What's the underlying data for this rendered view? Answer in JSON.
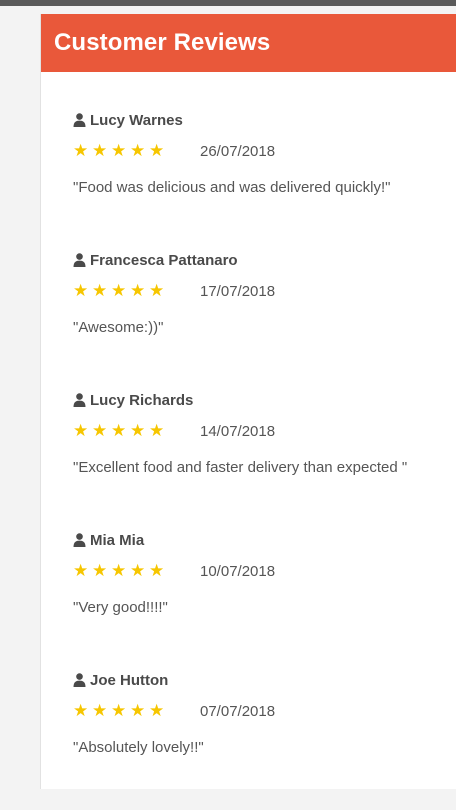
{
  "header": {
    "title": "Customer Reviews"
  },
  "colors": {
    "header_bg": "#e9583a",
    "star": "#f6c600",
    "top_bar": "#5a5a5a"
  },
  "reviews": [
    {
      "name": "Lucy Warnes",
      "rating": 5,
      "date": "26/07/2018",
      "comment": "\"Food was delicious and was delivered quickly!\""
    },
    {
      "name": "Francesca Pattanaro",
      "rating": 5,
      "date": "17/07/2018",
      "comment": "\"Awesome:))\""
    },
    {
      "name": "Lucy Richards",
      "rating": 5,
      "date": "14/07/2018",
      "comment": "\"Excellent food and faster delivery than expected \""
    },
    {
      "name": "Mia Mia",
      "rating": 5,
      "date": "10/07/2018",
      "comment": "\"Very good!!!!\""
    },
    {
      "name": "Joe Hutton",
      "rating": 5,
      "date": "07/07/2018",
      "comment": "\"Absolutely lovely!!\""
    }
  ]
}
